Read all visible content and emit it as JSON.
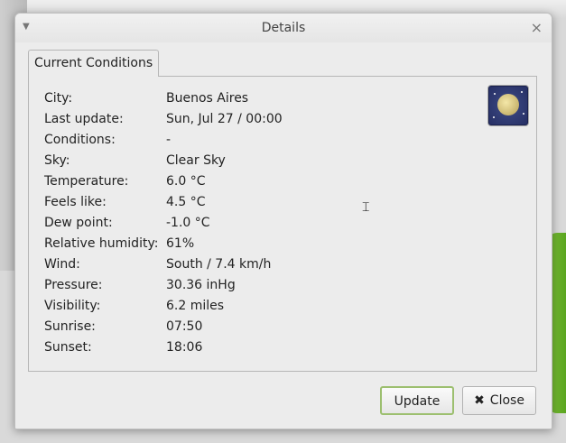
{
  "window": {
    "title": "Details",
    "menu_icon": "triangle-down-icon",
    "close_glyph": "×"
  },
  "tabs": [
    {
      "label": "Current Conditions"
    }
  ],
  "conditions": [
    {
      "label": "City:",
      "value": "Buenos Aires"
    },
    {
      "label": "Last update:",
      "value": "Sun, Jul 27 / 00:00"
    },
    {
      "label": "Conditions:",
      "value": "-"
    },
    {
      "label": "Sky:",
      "value": "Clear Sky"
    },
    {
      "label": "Temperature:",
      "value": "6.0 °C"
    },
    {
      "label": "Feels like:",
      "value": "4.5 °C"
    },
    {
      "label": "Dew point:",
      "value": "-1.0 °C"
    },
    {
      "label": "Relative humidity:",
      "value": "61%"
    },
    {
      "label": "Wind:",
      "value": "South / 7.4 km/h"
    },
    {
      "label": "Pressure:",
      "value": "30.36 inHg"
    },
    {
      "label": "Visibility:",
      "value": "6.2 miles"
    },
    {
      "label": "Sunrise:",
      "value": "07:50"
    },
    {
      "label": "Sunset:",
      "value": "18:06"
    }
  ],
  "weather_icon": "moon-clear-night-icon",
  "buttons": {
    "update_label": "Update",
    "close_label": "Close",
    "close_glyph": "✖"
  },
  "colors": {
    "update_border": "#9cbf6f",
    "moon_bg": "#2c356f"
  }
}
